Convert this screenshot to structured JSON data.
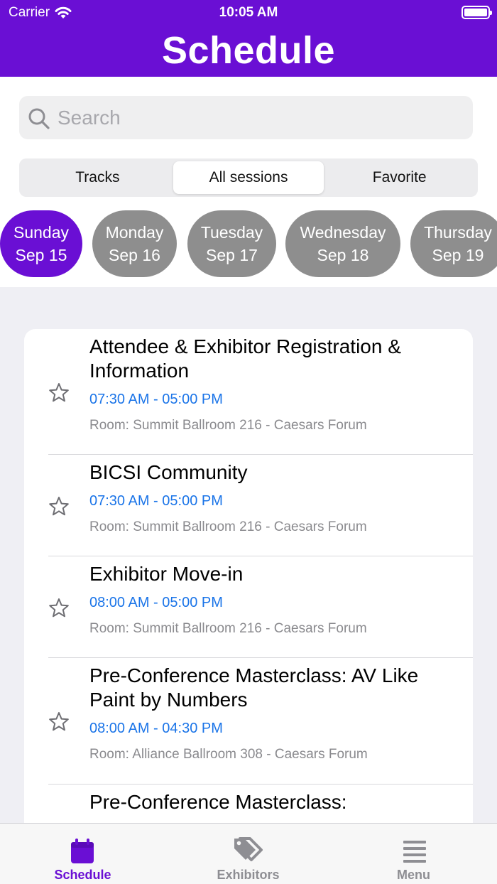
{
  "status": {
    "carrier": "Carrier",
    "time": "10:05 AM"
  },
  "header": {
    "title": "Schedule"
  },
  "search": {
    "placeholder": "Search"
  },
  "segments": {
    "tracks": "Tracks",
    "all": "All sessions",
    "favorite": "Favorite"
  },
  "days": [
    {
      "day": "Sunday",
      "date": "Sep 15"
    },
    {
      "day": "Monday",
      "date": "Sep 16"
    },
    {
      "day": "Tuesday",
      "date": "Sep 17"
    },
    {
      "day": "Wednesday",
      "date": "Sep 18"
    },
    {
      "day": "Thursday",
      "date": "Sep 19"
    }
  ],
  "sessions": [
    {
      "title": "Attendee & Exhibitor Registration & Information",
      "time": "07:30 AM - 05:00 PM",
      "room": "Room: Summit Ballroom 216 - Caesars Forum"
    },
    {
      "title": "BICSI Community",
      "time": "07:30 AM - 05:00 PM",
      "room": "Room: Summit Ballroom 216 - Caesars Forum"
    },
    {
      "title": "Exhibitor Move-in",
      "time": "08:00 AM - 05:00 PM",
      "room": "Room: Summit Ballroom 216 - Caesars Forum"
    },
    {
      "title": "Pre-Conference Masterclass: AV Like Paint by Numbers",
      "time": "08:00 AM - 04:30 PM",
      "room": "Room: Alliance Ballroom 308 - Caesars Forum"
    },
    {
      "title": "Pre-Conference Masterclass:",
      "time": "",
      "room": ""
    }
  ],
  "tabs": {
    "schedule": "Schedule",
    "exhibitors": "Exhibitors",
    "menu": "Menu"
  },
  "colors": {
    "primary": "#6a0fd4",
    "time": "#1a74e8",
    "inactive_day": "#8e8e8e"
  }
}
